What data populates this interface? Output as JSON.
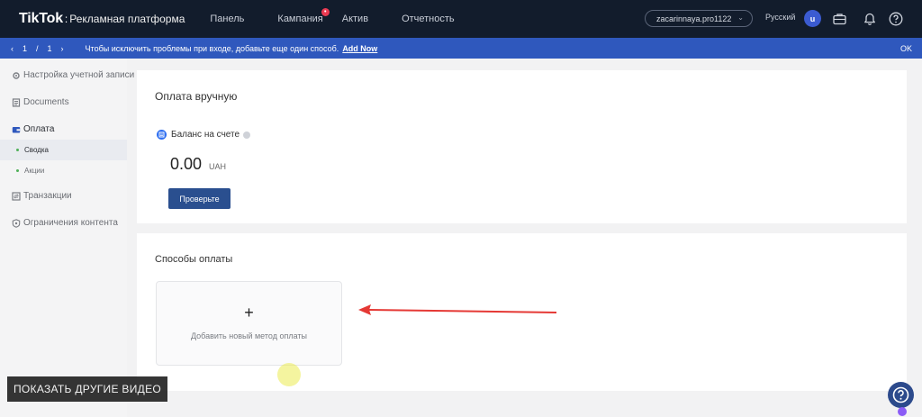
{
  "app": {
    "logo": "TikTok",
    "logo_separator": ":",
    "platform_name": "Рекламная платформа"
  },
  "nav": {
    "items": [
      {
        "label": "Панель"
      },
      {
        "label": "Кампания",
        "badge": "•"
      },
      {
        "label": "Актив"
      },
      {
        "label": "Отчетность"
      }
    ]
  },
  "header": {
    "account_name": "zacarinnaya.pro1122",
    "language": "Русский",
    "avatar_letter": "u"
  },
  "icons": {
    "briefcase": "briefcase-icon",
    "bell": "bell-icon",
    "help": "help-icon"
  },
  "banner": {
    "page_current": "1",
    "page_sep": "/",
    "page_total": "1",
    "prev": "‹",
    "next": "›",
    "message": "Чтобы исключить проблемы при входе, добавьте еще один способ.",
    "link": "Add Now",
    "ok": "OK"
  },
  "sidebar": {
    "items": [
      {
        "label": "Настройка учетной записи"
      },
      {
        "label": "Documents"
      },
      {
        "label": "Оплата"
      },
      {
        "label": "Сводка"
      },
      {
        "label": "Акции"
      },
      {
        "label": "Транзакции"
      },
      {
        "label": "Ограничения контента"
      }
    ]
  },
  "manual_payment": {
    "title": "Оплата вручную",
    "balance_label": "Баланс на счете",
    "amount": "0.00",
    "currency": "UAH",
    "check_button": "Проверьте"
  },
  "payment_methods": {
    "title": "Способы оплаты",
    "add_plus": "+",
    "add_label": "Добавить новый метод оплаты"
  },
  "overlay": {
    "show_videos": "ПОКАЗАТЬ ДРУГИЕ ВИДЕО",
    "help_glyph": "?"
  },
  "colors": {
    "topbar": "#121c2c",
    "banner": "#2f58bd",
    "primary_button": "#2a4f8f",
    "arrow": "#e53935"
  }
}
